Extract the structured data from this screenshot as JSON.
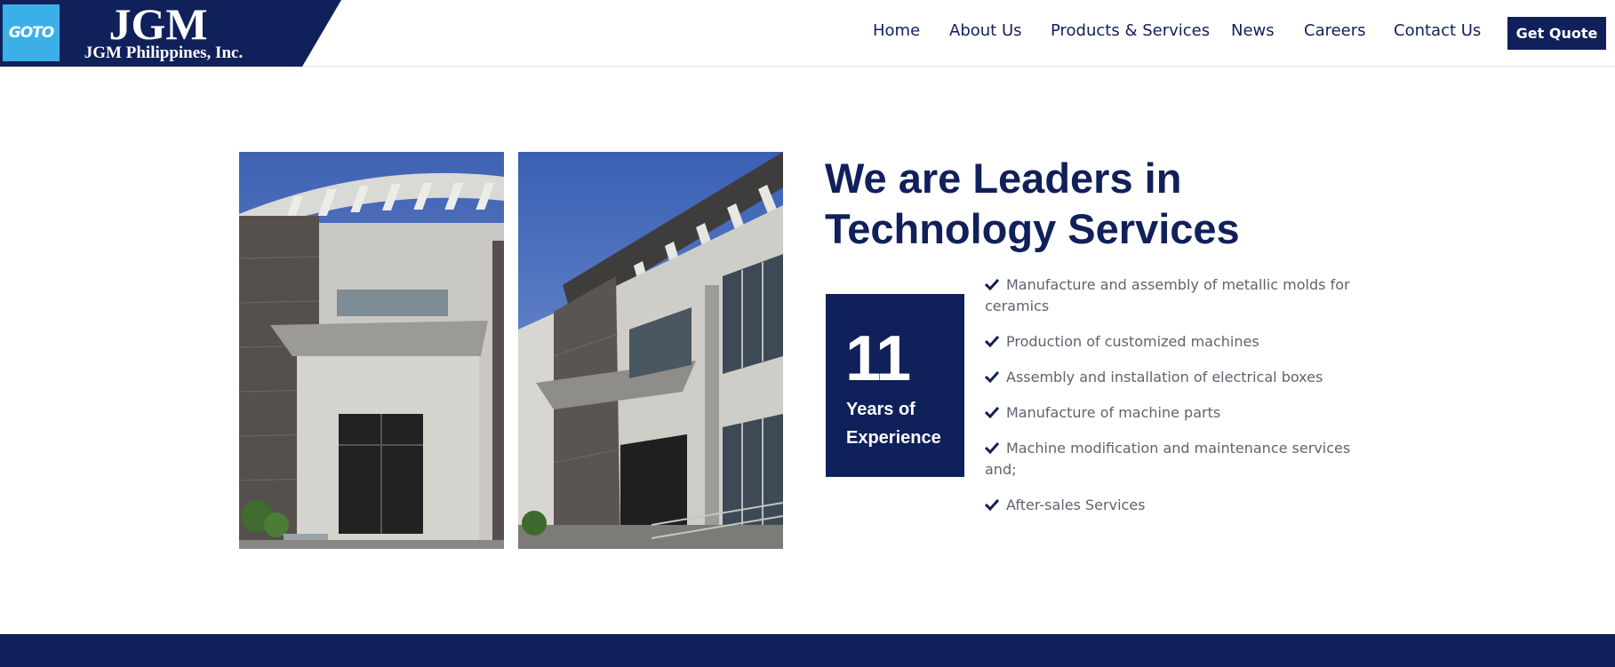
{
  "header": {
    "logo_badge_text": "GOTO",
    "brand_name": "JGM",
    "brand_subtitle": "JGM Philippines, Inc.",
    "nav": [
      {
        "label": "Home"
      },
      {
        "label": "About Us"
      },
      {
        "label": "Products & Services"
      },
      {
        "label": "News"
      },
      {
        "label": "Careers"
      },
      {
        "label": "Contact Us"
      }
    ],
    "cta_label": "Get Quote"
  },
  "main": {
    "headline": "We are Leaders in Technology Services",
    "experience": {
      "number": "11",
      "label": "Years of Experience"
    },
    "services": [
      "Manufacture and assembly of metallic molds for ceramics",
      "Production of customized machines",
      "Assembly and installation of electrical boxes",
      "Manufacture of machine parts",
      "Machine modification and maintenance services and;",
      "After-sales Services"
    ]
  },
  "colors": {
    "brand_navy": "#10205a",
    "badge_blue": "#3cb0e6",
    "body_text": "#5f6370"
  },
  "icons": [
    "check-icon"
  ]
}
